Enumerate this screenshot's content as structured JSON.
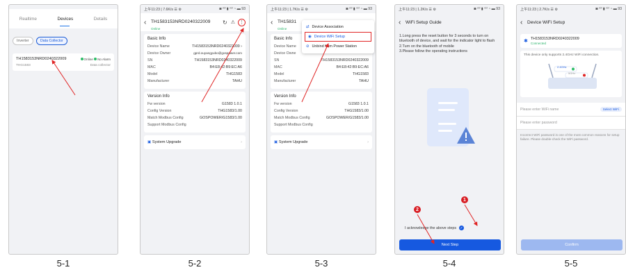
{
  "captions": [
    "5-1",
    "5-2",
    "5-3",
    "5-4",
    "5-5"
  ],
  "colors": {
    "primary": "#1659e0",
    "online": "#2ebd67",
    "highlight": "#e02525"
  },
  "s1": {
    "tabs": [
      "Realtime",
      "Devices",
      "Details"
    ],
    "chips": [
      "Inverter",
      "Data Collector"
    ],
    "device_sn": "TH1583153NRD0240322009",
    "status_online": "Online",
    "status_alarm": "No Alarm",
    "model": "THG1583",
    "type": "Data collector"
  },
  "s2": {
    "status_left": "上午11:23 | 7.6K/s ☰ ⚙",
    "status_right": "◙ ᵛᵒˡ ▮ ᵛᵒˡ ◔ ▬ 93",
    "title": "TH1583153NRD0240322009",
    "subtitle": "Online",
    "basic_title": "Basic Info",
    "basic": [
      {
        "k": "Device Name",
        "v": "TH1583153NRD0240322009 ›"
      },
      {
        "k": "Device Owner",
        "v": "gprd.ouyangyubo@gospower.com"
      },
      {
        "k": "SN",
        "v": "TH1583153NRD0240322009"
      },
      {
        "k": "MAC",
        "v": "B4:E8:42:B9:EC:A6"
      },
      {
        "k": "Model",
        "v": "THG1583"
      },
      {
        "k": "Manufacturer",
        "v": "TAHU"
      }
    ],
    "version_title": "Version Info",
    "version": [
      {
        "k": "Fw version",
        "v": "G1583 1.0.1"
      },
      {
        "k": "Config Version",
        "v": "THG1583/1.00"
      },
      {
        "k": "Match Modbus Config",
        "v": "GOSPOWER/G1583/1.00"
      },
      {
        "k": "Support Modbus Config",
        "v": ""
      }
    ],
    "upgrade": "System Upgrade"
  },
  "s3": {
    "status_left": "上午11:23 | 1.7K/s ☰ ⚙",
    "title": "TH15831",
    "subtitle": "Online",
    "menu": [
      "Device Association",
      "Device WiFi Setup",
      "Unbind from Power Station"
    ],
    "basic_title": "Basic Info",
    "basic": [
      {
        "k": "Device Name",
        "v": ""
      },
      {
        "k": "Device Owne",
        "v": ""
      },
      {
        "k": "SN",
        "v": "TH1583153NRD0240322009"
      },
      {
        "k": "MAC",
        "v": "B4:E8:42:B9:EC:A6"
      },
      {
        "k": "Model",
        "v": "THG1583"
      },
      {
        "k": "Manufacturer",
        "v": "TAHU"
      }
    ],
    "version_title": "Version Info",
    "version": [
      {
        "k": "Fw version",
        "v": "G1583 1.0.1"
      },
      {
        "k": "Config Version",
        "v": "THG1583/1.00"
      },
      {
        "k": "Match Modbus Config",
        "v": "GOSPOWER/G1583/1.00"
      },
      {
        "k": "Support Modbus Config",
        "v": ""
      }
    ],
    "upgrade": "System Upgrade"
  },
  "s4": {
    "status_left": "上午11:23 | 1.2K/s ☰ ⚙",
    "title": "WiFi Setup Guide",
    "steps": "1.Long press the reset button for 3 seconds to turn on bluetooth of device, and wait for the indicator light to flash\n2.Turn on the bluetooth of mobile\n3.Please follow the operating instructions",
    "ack": "I acknowledge the above steps",
    "next": "Next Step",
    "badge1": "1",
    "badge2": "2"
  },
  "s5": {
    "status_left": "上午11:23 | 2.7K/s ☰ ⚙",
    "title": "Device WiFi Setup",
    "device": "TH1583153NRD0240322009",
    "device_status": "Connected",
    "note": "This device only supports 2.4GHz WiFi connection.",
    "router_24": "2.4GHz",
    "router_5": "5GHz",
    "wifi_placeholder": "Please enter WiFi name",
    "select_wifi": "Select WiFi",
    "pwd_placeholder": "Please enter password",
    "warning": "Incorrect WiFi password is one of the most common reasons for setup failure. Please double-check the WiFi password.",
    "confirm": "Confirm"
  }
}
